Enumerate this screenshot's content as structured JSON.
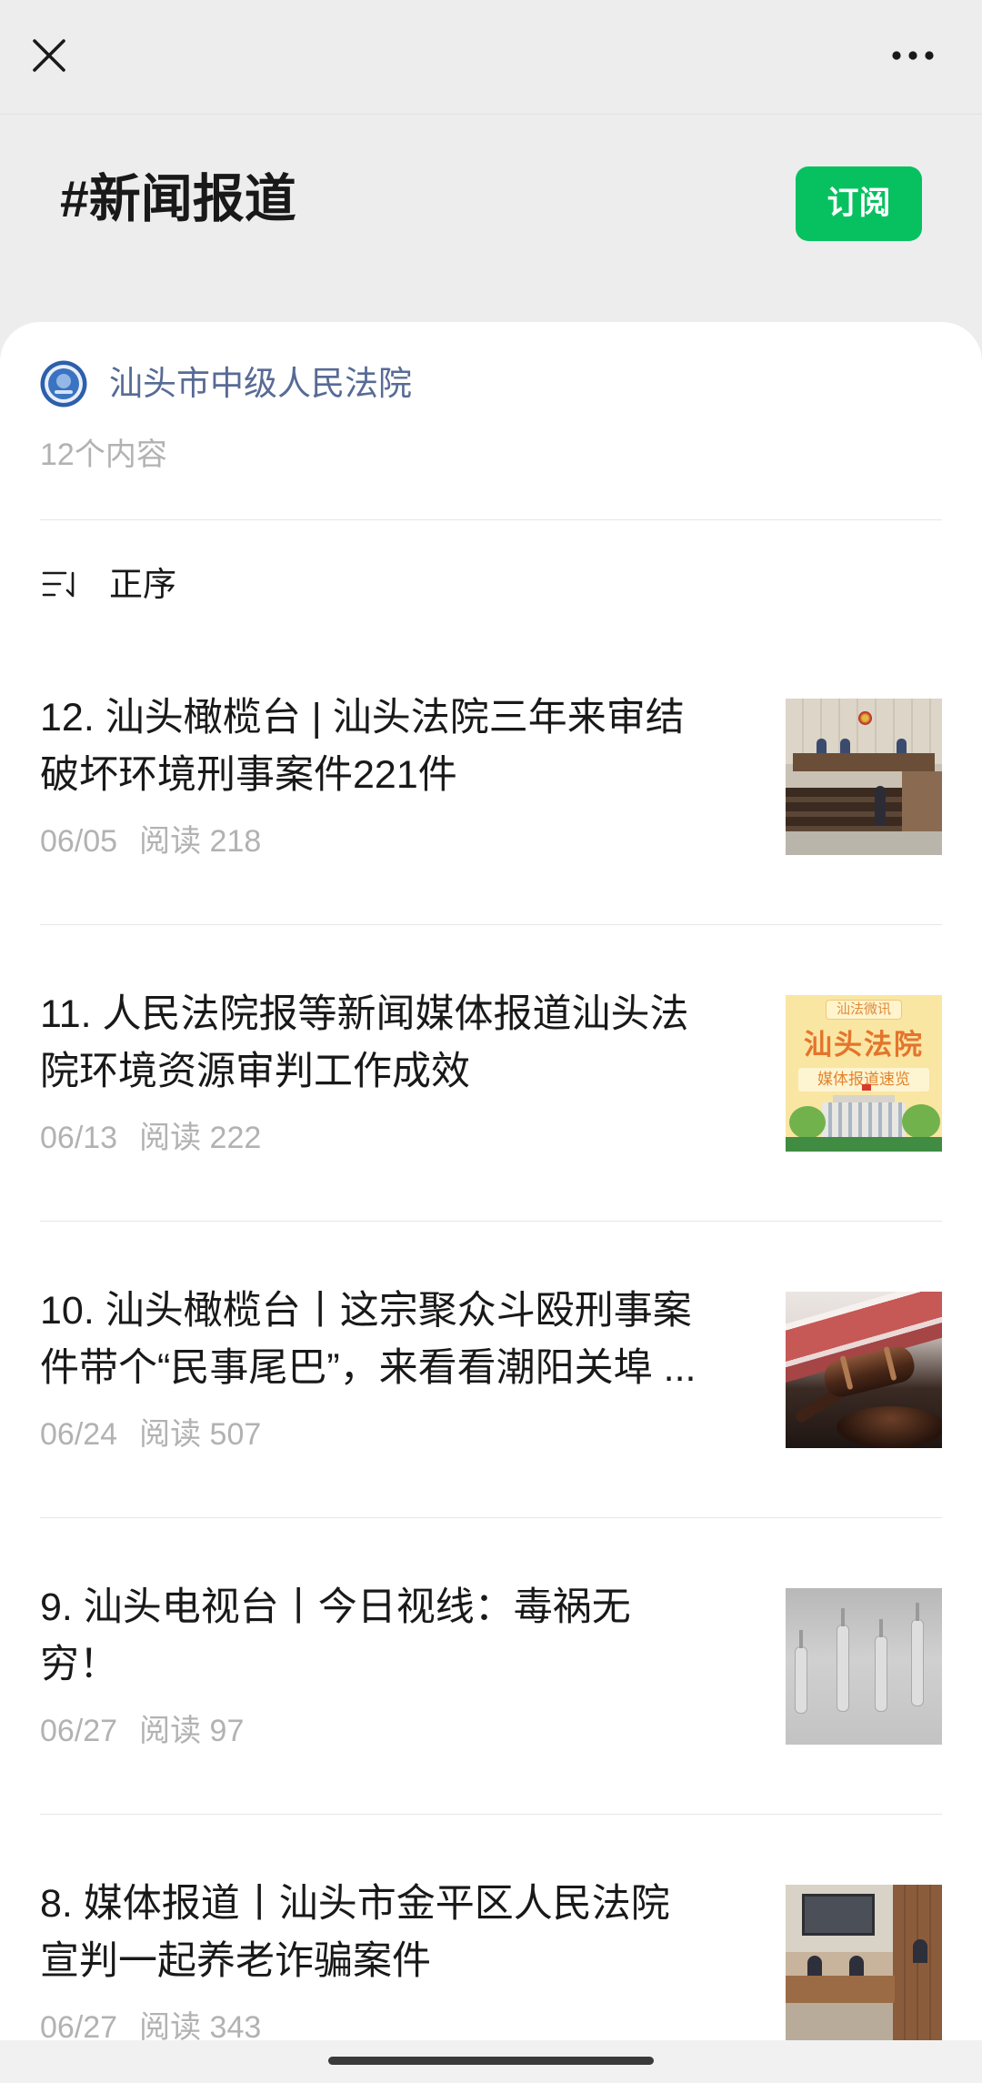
{
  "topbar": {
    "close_icon": "close-icon",
    "more_icon": "more-icon"
  },
  "topic": {
    "title": "#新闻报道",
    "subscribe_label": "订阅"
  },
  "account": {
    "avatar_icon": "court-emblem-icon",
    "name": "汕头市中级人民法院",
    "content_count": "12个内容"
  },
  "sort": {
    "icon": "sort-order-icon",
    "label": "正序"
  },
  "articles": [
    {
      "title_lines": [
        "12. 汕头橄榄台 | 汕头法院三年来审结",
        "破坏环境刑事案件221件"
      ],
      "date": "06/05",
      "reads": "阅读 218"
    },
    {
      "title_lines": [
        "11. 人民法院报等新闻媒体报道汕头法",
        "院环境资源审判工作成效"
      ],
      "date": "06/13",
      "reads": "阅读 222",
      "thumbnail_text": {
        "tag": "汕法微讯",
        "heading": "汕头法院",
        "subheading": "媒体报道速览"
      }
    },
    {
      "title_lines": [
        "10. 汕头橄榄台丨这宗聚众斗殴刑事案",
        "件带个“民事尾巴”，来看看潮阳关埠"
      ],
      "truncation": "...",
      "date": "06/24",
      "reads": "阅读 507"
    },
    {
      "title_lines": [
        "9. 汕头电视台丨今日视线：毒祸无",
        "穷！"
      ],
      "date": "06/27",
      "reads": "阅读 97"
    },
    {
      "title_lines": [
        "8. 媒体报道丨汕头市金平区人民法院",
        "宣判一起养老诈骗案件"
      ],
      "date": "06/27",
      "reads": "阅读 343"
    }
  ],
  "colors": {
    "accent": "#07c160",
    "link": "#576b95",
    "meta": "#b2b2b2"
  }
}
